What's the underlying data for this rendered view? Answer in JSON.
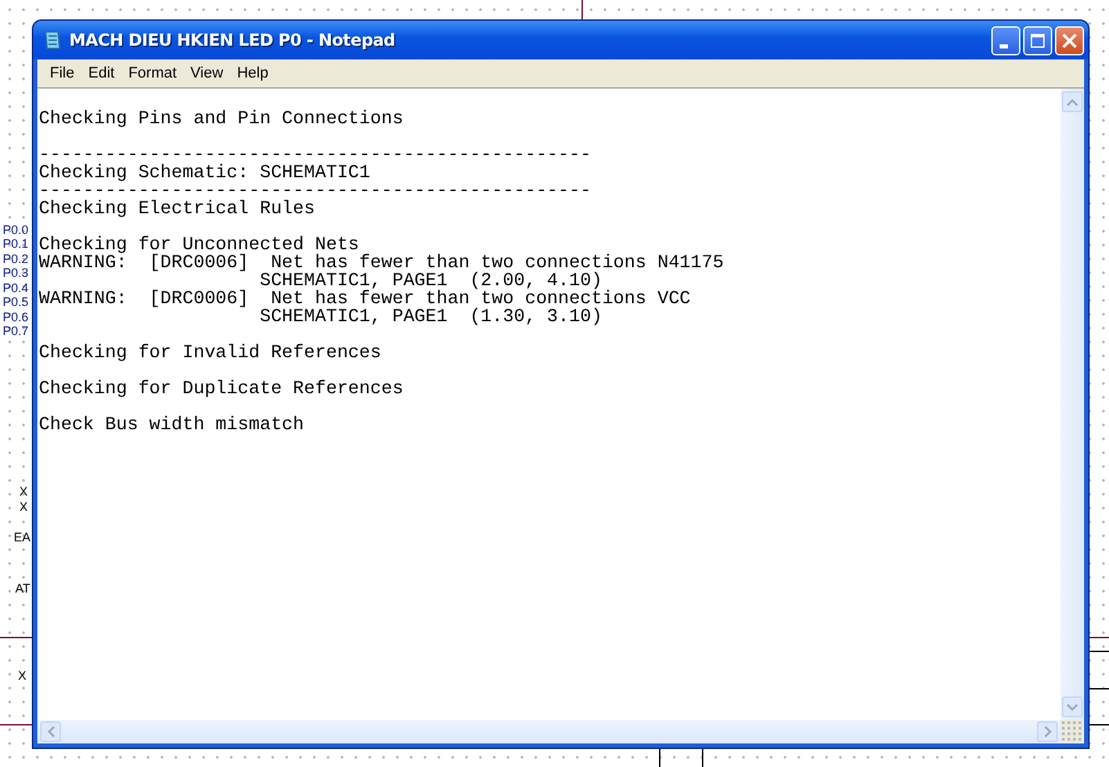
{
  "canvas_labels": [
    "P0.0",
    "P0.1",
    "P0.2",
    "P0.3",
    "P0.4",
    "P0.5",
    "P0.6",
    "P0.7",
    "X",
    "X",
    "EA",
    "AT",
    "X"
  ],
  "window": {
    "title": "MACH DIEU HKIEN LED P0 - Notepad",
    "menu": [
      "File",
      "Edit",
      "Format",
      "View",
      "Help"
    ],
    "text": "\nChecking Pins and Pin Connections\n\n--------------------------------------------------\nChecking Schematic: SCHEMATIC1\n--------------------------------------------------\nChecking Electrical Rules\n\nChecking for Unconnected Nets\nWARNING:  [DRC0006]  Net has fewer than two connections N41175\n                    SCHEMATIC1, PAGE1  (2.00, 4.10)\nWARNING:  [DRC0006]  Net has fewer than two connections VCC\n                    SCHEMATIC1, PAGE1  (1.30, 3.10)\n\nChecking for Invalid References\n\nChecking for Duplicate References\n\nCheck Bus width mismatch"
  }
}
